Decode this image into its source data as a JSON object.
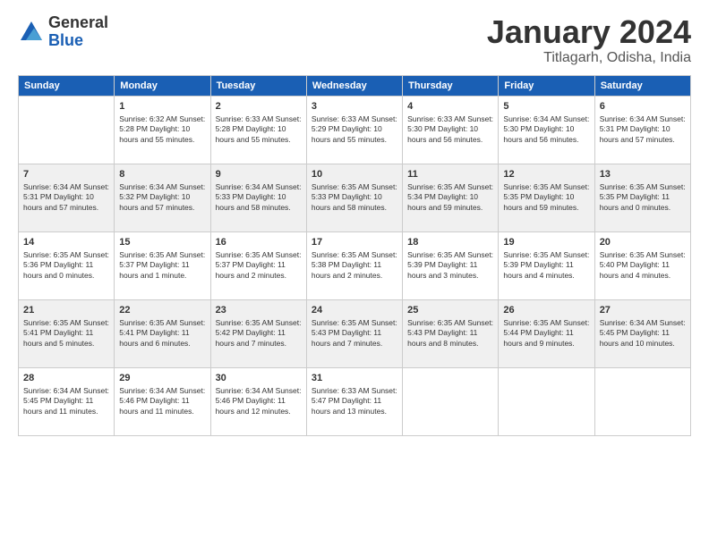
{
  "header": {
    "logo_general": "General",
    "logo_blue": "Blue",
    "month_title": "January 2024",
    "location": "Titlagarh, Odisha, India"
  },
  "days_of_week": [
    "Sunday",
    "Monday",
    "Tuesday",
    "Wednesday",
    "Thursday",
    "Friday",
    "Saturday"
  ],
  "weeks": [
    [
      {
        "day": "",
        "content": ""
      },
      {
        "day": "1",
        "content": "Sunrise: 6:32 AM\nSunset: 5:28 PM\nDaylight: 10 hours\nand 55 minutes."
      },
      {
        "day": "2",
        "content": "Sunrise: 6:33 AM\nSunset: 5:28 PM\nDaylight: 10 hours\nand 55 minutes."
      },
      {
        "day": "3",
        "content": "Sunrise: 6:33 AM\nSunset: 5:29 PM\nDaylight: 10 hours\nand 55 minutes."
      },
      {
        "day": "4",
        "content": "Sunrise: 6:33 AM\nSunset: 5:30 PM\nDaylight: 10 hours\nand 56 minutes."
      },
      {
        "day": "5",
        "content": "Sunrise: 6:34 AM\nSunset: 5:30 PM\nDaylight: 10 hours\nand 56 minutes."
      },
      {
        "day": "6",
        "content": "Sunrise: 6:34 AM\nSunset: 5:31 PM\nDaylight: 10 hours\nand 57 minutes."
      }
    ],
    [
      {
        "day": "7",
        "content": "Sunrise: 6:34 AM\nSunset: 5:31 PM\nDaylight: 10 hours\nand 57 minutes."
      },
      {
        "day": "8",
        "content": "Sunrise: 6:34 AM\nSunset: 5:32 PM\nDaylight: 10 hours\nand 57 minutes."
      },
      {
        "day": "9",
        "content": "Sunrise: 6:34 AM\nSunset: 5:33 PM\nDaylight: 10 hours\nand 58 minutes."
      },
      {
        "day": "10",
        "content": "Sunrise: 6:35 AM\nSunset: 5:33 PM\nDaylight: 10 hours\nand 58 minutes."
      },
      {
        "day": "11",
        "content": "Sunrise: 6:35 AM\nSunset: 5:34 PM\nDaylight: 10 hours\nand 59 minutes."
      },
      {
        "day": "12",
        "content": "Sunrise: 6:35 AM\nSunset: 5:35 PM\nDaylight: 10 hours\nand 59 minutes."
      },
      {
        "day": "13",
        "content": "Sunrise: 6:35 AM\nSunset: 5:35 PM\nDaylight: 11 hours\nand 0 minutes."
      }
    ],
    [
      {
        "day": "14",
        "content": "Sunrise: 6:35 AM\nSunset: 5:36 PM\nDaylight: 11 hours\nand 0 minutes."
      },
      {
        "day": "15",
        "content": "Sunrise: 6:35 AM\nSunset: 5:37 PM\nDaylight: 11 hours\nand 1 minute."
      },
      {
        "day": "16",
        "content": "Sunrise: 6:35 AM\nSunset: 5:37 PM\nDaylight: 11 hours\nand 2 minutes."
      },
      {
        "day": "17",
        "content": "Sunrise: 6:35 AM\nSunset: 5:38 PM\nDaylight: 11 hours\nand 2 minutes."
      },
      {
        "day": "18",
        "content": "Sunrise: 6:35 AM\nSunset: 5:39 PM\nDaylight: 11 hours\nand 3 minutes."
      },
      {
        "day": "19",
        "content": "Sunrise: 6:35 AM\nSunset: 5:39 PM\nDaylight: 11 hours\nand 4 minutes."
      },
      {
        "day": "20",
        "content": "Sunrise: 6:35 AM\nSunset: 5:40 PM\nDaylight: 11 hours\nand 4 minutes."
      }
    ],
    [
      {
        "day": "21",
        "content": "Sunrise: 6:35 AM\nSunset: 5:41 PM\nDaylight: 11 hours\nand 5 minutes."
      },
      {
        "day": "22",
        "content": "Sunrise: 6:35 AM\nSunset: 5:41 PM\nDaylight: 11 hours\nand 6 minutes."
      },
      {
        "day": "23",
        "content": "Sunrise: 6:35 AM\nSunset: 5:42 PM\nDaylight: 11 hours\nand 7 minutes."
      },
      {
        "day": "24",
        "content": "Sunrise: 6:35 AM\nSunset: 5:43 PM\nDaylight: 11 hours\nand 7 minutes."
      },
      {
        "day": "25",
        "content": "Sunrise: 6:35 AM\nSunset: 5:43 PM\nDaylight: 11 hours\nand 8 minutes."
      },
      {
        "day": "26",
        "content": "Sunrise: 6:35 AM\nSunset: 5:44 PM\nDaylight: 11 hours\nand 9 minutes."
      },
      {
        "day": "27",
        "content": "Sunrise: 6:34 AM\nSunset: 5:45 PM\nDaylight: 11 hours\nand 10 minutes."
      }
    ],
    [
      {
        "day": "28",
        "content": "Sunrise: 6:34 AM\nSunset: 5:45 PM\nDaylight: 11 hours\nand 11 minutes."
      },
      {
        "day": "29",
        "content": "Sunrise: 6:34 AM\nSunset: 5:46 PM\nDaylight: 11 hours\nand 11 minutes."
      },
      {
        "day": "30",
        "content": "Sunrise: 6:34 AM\nSunset: 5:46 PM\nDaylight: 11 hours\nand 12 minutes."
      },
      {
        "day": "31",
        "content": "Sunrise: 6:33 AM\nSunset: 5:47 PM\nDaylight: 11 hours\nand 13 minutes."
      },
      {
        "day": "",
        "content": ""
      },
      {
        "day": "",
        "content": ""
      },
      {
        "day": "",
        "content": ""
      }
    ]
  ]
}
